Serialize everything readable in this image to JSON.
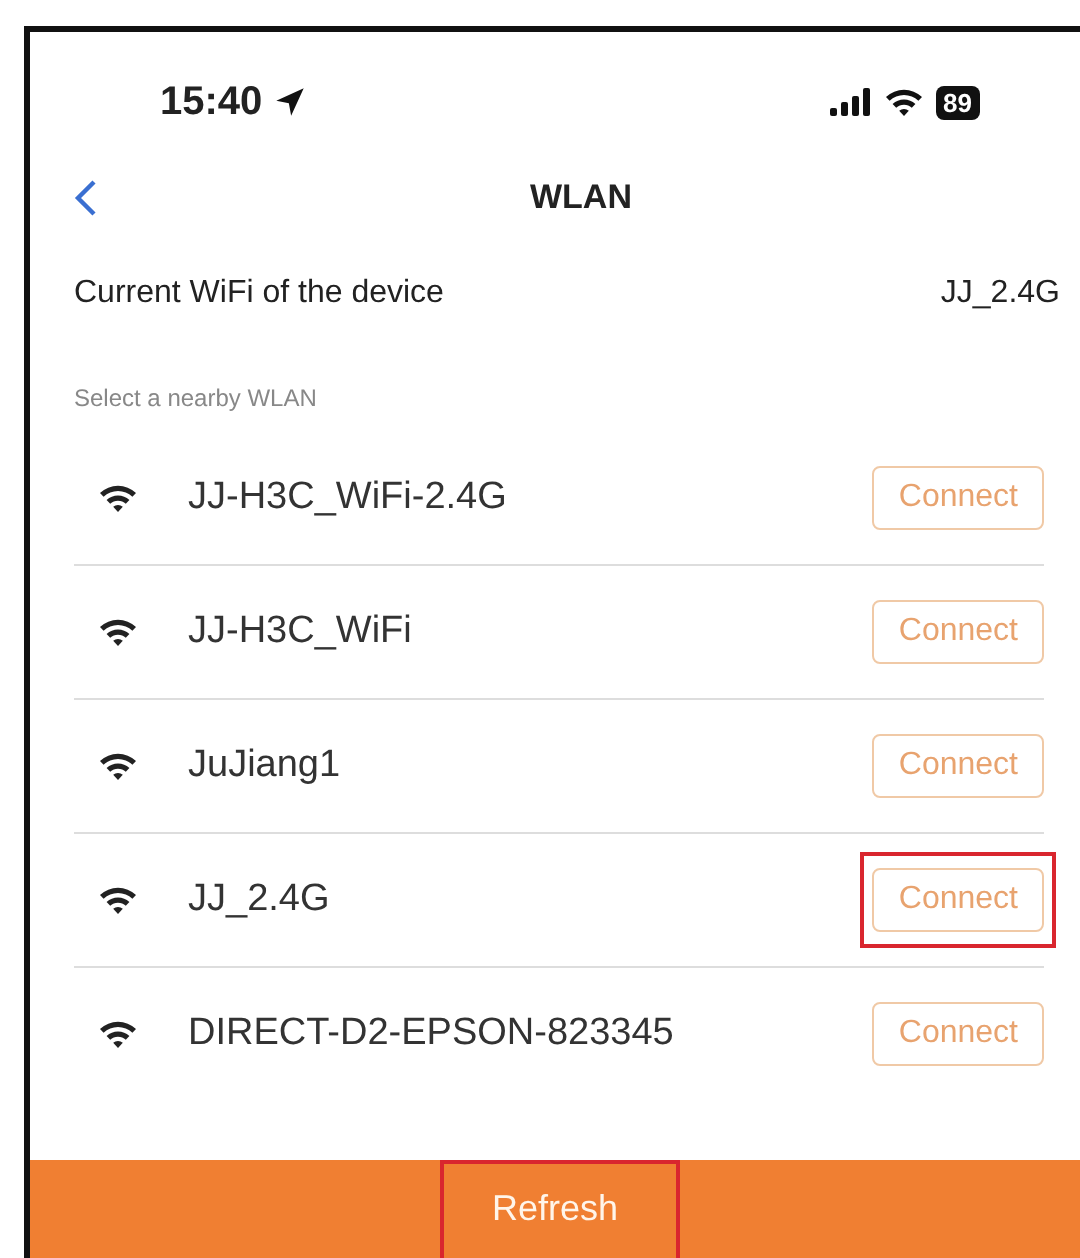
{
  "status_bar": {
    "time": "15:40",
    "battery": "89"
  },
  "nav": {
    "title": "WLAN"
  },
  "current": {
    "label": "Current WiFi of the device",
    "value": "JJ_2.4G"
  },
  "section_label": "Select a nearby WLAN",
  "networks": [
    {
      "name": "JJ-H3C_WiFi-2.4G",
      "button": "Connect",
      "highlighted": false
    },
    {
      "name": "JJ-H3C_WiFi",
      "button": "Connect",
      "highlighted": false
    },
    {
      "name": "JuJiang1",
      "button": "Connect",
      "highlighted": false
    },
    {
      "name": "JJ_2.4G",
      "button": "Connect",
      "highlighted": true
    },
    {
      "name": "DIRECT-D2-EPSON-823345",
      "button": "Connect",
      "highlighted": false
    }
  ],
  "refresh": {
    "label": "Refresh",
    "highlighted": true
  }
}
